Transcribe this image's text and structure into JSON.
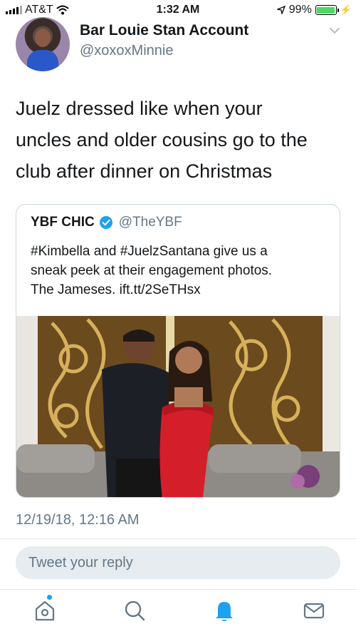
{
  "status_bar": {
    "carrier": "AT&T",
    "time": "1:32 AM",
    "battery_percent": "99%",
    "battery_level": 0.99,
    "icons": [
      "signal-bars-icon",
      "wifi-icon",
      "location-arrow-icon",
      "battery-icon",
      "charging-bolt-icon"
    ]
  },
  "tweet": {
    "author": {
      "display_name": "Bar Louie Stan Account",
      "handle": "@xoxoxMinnie"
    },
    "text_lines": [
      "Juelz dressed like when your",
      "uncles and older cousins go to the",
      "club after dinner on Christmas"
    ],
    "timestamp": "12/19/18, 12:16 AM"
  },
  "quoted_tweet": {
    "display_name": "YBF CHIC",
    "handle": "@TheYBF",
    "text_lines": [
      "#Kimbella and #JuelzSantana give us a",
      "sneak peek at their engagement photos.",
      "The Jameses. ift.tt/2SeTHsx"
    ]
  },
  "reply": {
    "placeholder": "Tweet your reply"
  },
  "tab_bar": {
    "tabs": [
      "home-icon",
      "search-icon",
      "notifications-bell-icon",
      "messages-envelope-icon"
    ],
    "active_tab": "notifications-bell-icon"
  },
  "colors": {
    "accent": "#1da1f2",
    "secondary_text": "#657786",
    "primary_text": "#14171a",
    "border": "#ccd6dd",
    "reply_bg": "#e6ecf0",
    "battery_green": "#4cd964"
  }
}
